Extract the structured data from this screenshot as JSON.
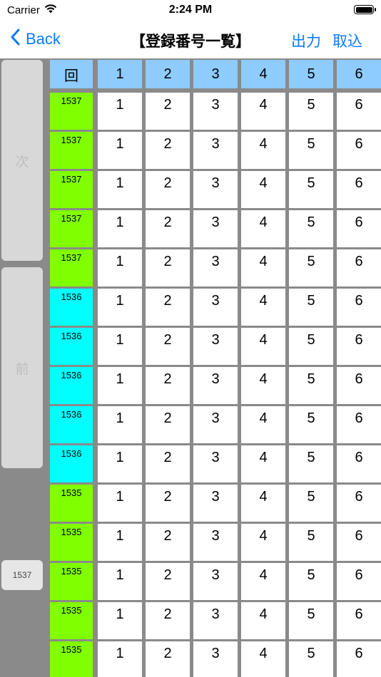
{
  "status": {
    "carrier": "Carrier",
    "time": "2:24 PM"
  },
  "nav": {
    "back_label": "Back",
    "title": "【登録番号一覧】",
    "export_label": "出力",
    "import_label": "取込"
  },
  "side": {
    "next_label": "次",
    "prev_label": "前",
    "round_value": "1537"
  },
  "colors": {
    "header": "#8ecbff",
    "round_1537": "#80ff00",
    "round_1536": "#00ffff",
    "round_1535": "#80ff00",
    "accent": "#0a7aff"
  },
  "table": {
    "headers": [
      "回",
      "1",
      "2",
      "3",
      "4",
      "5",
      "6"
    ],
    "rows": [
      {
        "round": "1537",
        "numbers": [
          "1",
          "2",
          "3",
          "4",
          "5",
          "6"
        ]
      },
      {
        "round": "1537",
        "numbers": [
          "1",
          "2",
          "3",
          "4",
          "5",
          "6"
        ]
      },
      {
        "round": "1537",
        "numbers": [
          "1",
          "2",
          "3",
          "4",
          "5",
          "6"
        ]
      },
      {
        "round": "1537",
        "numbers": [
          "1",
          "2",
          "3",
          "4",
          "5",
          "6"
        ]
      },
      {
        "round": "1537",
        "numbers": [
          "1",
          "2",
          "3",
          "4",
          "5",
          "6"
        ]
      },
      {
        "round": "1536",
        "numbers": [
          "1",
          "2",
          "3",
          "4",
          "5",
          "6"
        ]
      },
      {
        "round": "1536",
        "numbers": [
          "1",
          "2",
          "3",
          "4",
          "5",
          "6"
        ]
      },
      {
        "round": "1536",
        "numbers": [
          "1",
          "2",
          "3",
          "4",
          "5",
          "6"
        ]
      },
      {
        "round": "1536",
        "numbers": [
          "1",
          "2",
          "3",
          "4",
          "5",
          "6"
        ]
      },
      {
        "round": "1536",
        "numbers": [
          "1",
          "2",
          "3",
          "4",
          "5",
          "6"
        ]
      },
      {
        "round": "1535",
        "numbers": [
          "1",
          "2",
          "3",
          "4",
          "5",
          "6"
        ]
      },
      {
        "round": "1535",
        "numbers": [
          "1",
          "2",
          "3",
          "4",
          "5",
          "6"
        ]
      },
      {
        "round": "1535",
        "numbers": [
          "1",
          "2",
          "3",
          "4",
          "5",
          "6"
        ]
      },
      {
        "round": "1535",
        "numbers": [
          "1",
          "2",
          "3",
          "4",
          "5",
          "6"
        ]
      },
      {
        "round": "1535",
        "numbers": [
          "1",
          "2",
          "3",
          "4",
          "5",
          "6"
        ]
      }
    ]
  }
}
